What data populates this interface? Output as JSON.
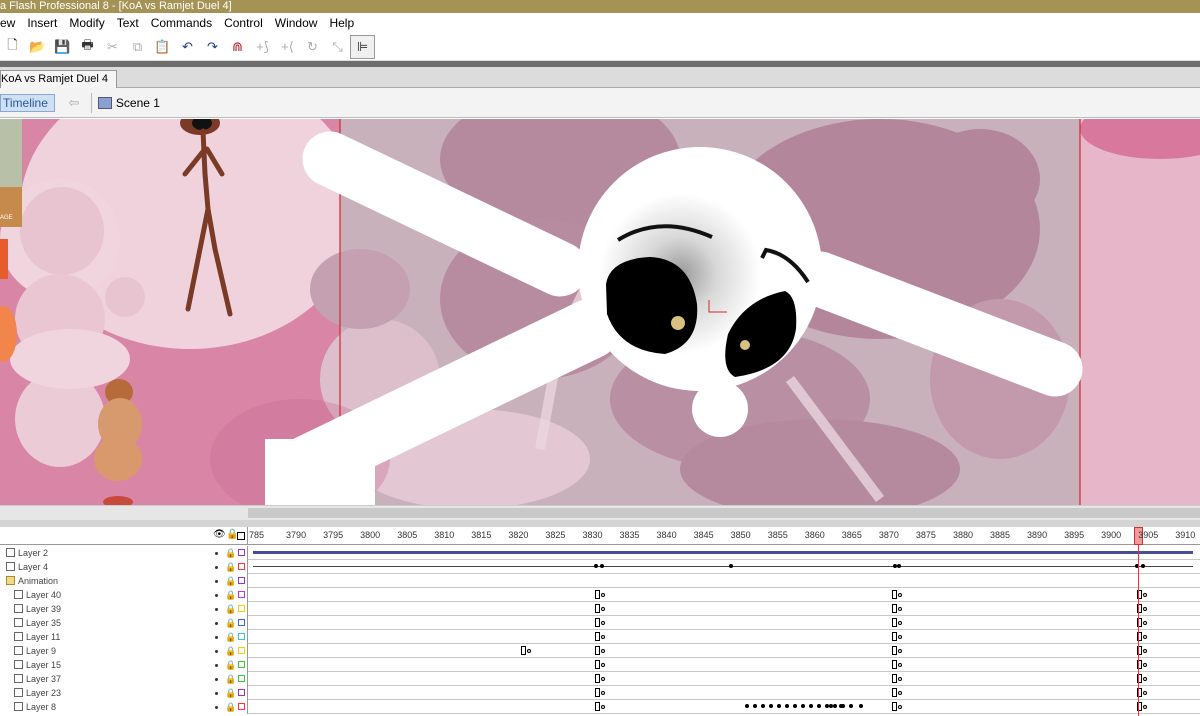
{
  "window": {
    "title": "a Flash Professional 8 - [KoA vs Ramjet Duel 4]"
  },
  "menu": [
    "ew",
    "Insert",
    "Modify",
    "Text",
    "Commands",
    "Control",
    "Window",
    "Help"
  ],
  "toolbar": {
    "icons": [
      "new-file-icon",
      "open-folder-icon",
      "save-icon",
      "print-icon",
      "cut-icon",
      "copy-icon",
      "paste-icon",
      "undo-icon",
      "redo-icon",
      "snap-magnet-icon",
      "smooth-icon",
      "straighten-icon",
      "rotate-icon",
      "scale-icon",
      "align-icon"
    ]
  },
  "document_tab": {
    "label": "KoA vs Ramjet Duel 4"
  },
  "edit_bar": {
    "timeline_label": "Timeline",
    "scene_label": "Scene 1"
  },
  "stage": {
    "side_label": "AGE"
  },
  "timeline": {
    "ruler_labels": [
      "785",
      "3790",
      "3795",
      "3800",
      "3805",
      "3810",
      "3815",
      "3820",
      "3825",
      "3830",
      "3835",
      "3840",
      "3845",
      "3850",
      "3855",
      "3860",
      "3865",
      "3870",
      "3875",
      "3880",
      "3885",
      "3890",
      "3895",
      "3900",
      "3905",
      "3910"
    ],
    "current_frame_label": "3905",
    "layers": [
      {
        "name": "Layer 2",
        "indent": 0,
        "type": "layer",
        "color": "#9933cc"
      },
      {
        "name": "Layer 4",
        "indent": 0,
        "type": "layer",
        "color": "#ff3333"
      },
      {
        "name": "Animation",
        "indent": 0,
        "type": "folder",
        "color": "#9933cc"
      },
      {
        "name": "Layer 40",
        "indent": 1,
        "type": "layer",
        "color": "#cc33cc"
      },
      {
        "name": "Layer 39",
        "indent": 1,
        "type": "layer",
        "color": "#ffcc00"
      },
      {
        "name": "Layer 35",
        "indent": 1,
        "type": "layer",
        "color": "#3366ff"
      },
      {
        "name": "Layer 11",
        "indent": 1,
        "type": "layer",
        "color": "#33cccc"
      },
      {
        "name": "Layer 9",
        "indent": 1,
        "type": "layer",
        "color": "#ffcc00"
      },
      {
        "name": "Layer 15",
        "indent": 1,
        "type": "layer",
        "color": "#33cc33"
      },
      {
        "name": "Layer 37",
        "indent": 1,
        "type": "layer",
        "color": "#33cc33"
      },
      {
        "name": "Layer 23",
        "indent": 1,
        "type": "layer",
        "color": "#9933cc"
      },
      {
        "name": "Layer 8",
        "indent": 1,
        "type": "layer",
        "color": "#ff3333"
      }
    ]
  },
  "colors": {
    "titlebar": "#a59356",
    "stage_pink": "#e8b8c8",
    "playhead": "#e33333"
  }
}
